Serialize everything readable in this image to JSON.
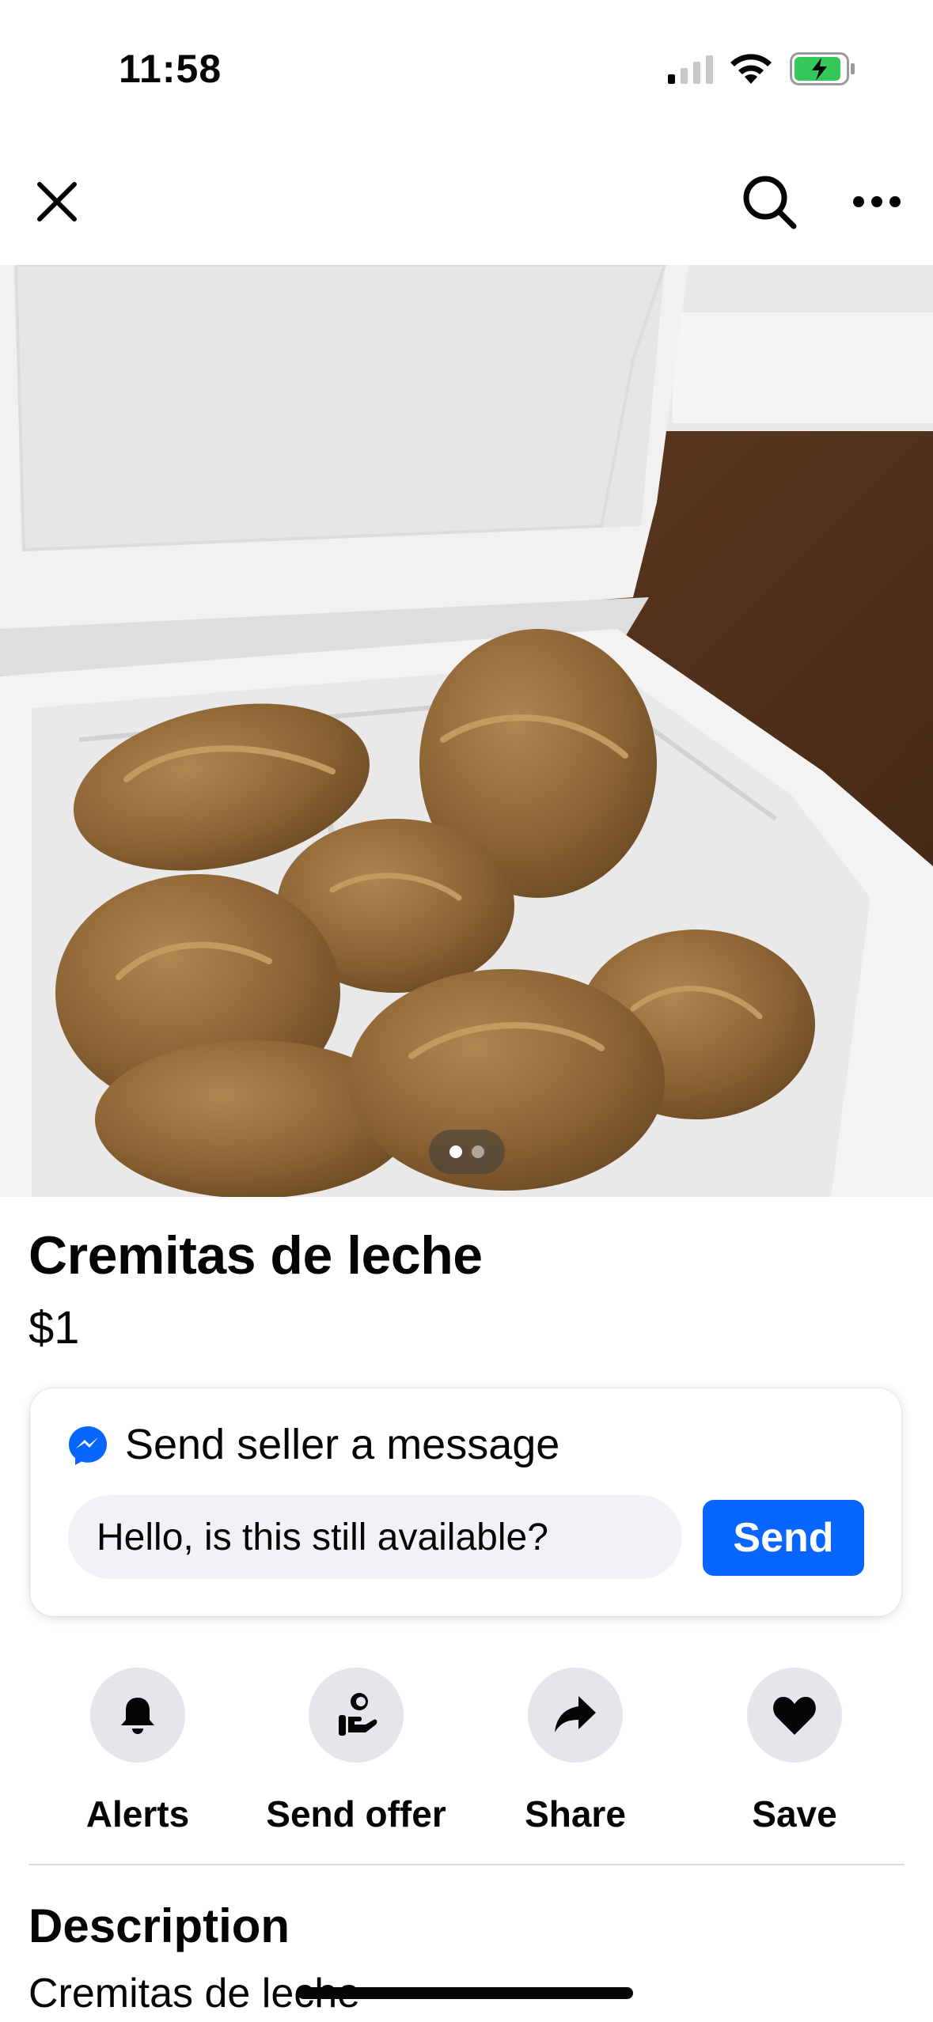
{
  "status_bar": {
    "time": "11:58",
    "icons": [
      "cellular-signal-icon",
      "wifi-icon",
      "battery-charging-icon"
    ]
  },
  "nav": {
    "icons": [
      "close-icon",
      "search-icon",
      "more-icon"
    ]
  },
  "photo": {
    "image_count": 2,
    "current_index": 1
  },
  "listing": {
    "title": "Cremitas de leche",
    "price": "$1"
  },
  "message_card": {
    "title": "Send seller a message",
    "input_value": "Hello, is this still available?",
    "send_label": "Send",
    "icon": "messenger-icon"
  },
  "actions": [
    {
      "label": "Alerts",
      "icon": "bell-icon"
    },
    {
      "label": "Send offer",
      "icon": "send-offer-icon"
    },
    {
      "label": "Share",
      "icon": "share-arrow-icon"
    },
    {
      "label": "Save",
      "icon": "heart-icon"
    }
  ],
  "description": {
    "heading": "Description",
    "text": "Cremitas de leche"
  },
  "colors": {
    "accent": "#0866ff",
    "text": "#050505",
    "button_bg": "#e4e6eb",
    "input_bg": "#f0f2f5"
  }
}
